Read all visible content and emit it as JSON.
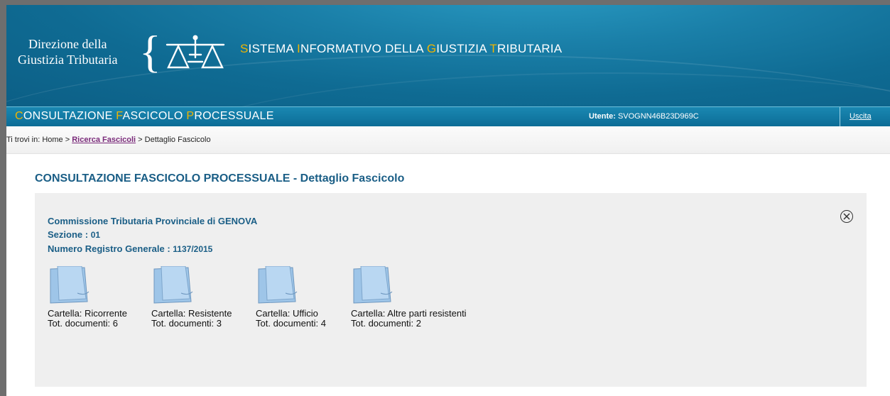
{
  "header": {
    "org_line1": "Direzione della",
    "org_line2": "Giustizia Tributaria",
    "system_title": [
      {
        "hl": "S",
        "rest": "ISTEMA "
      },
      {
        "hl": "I",
        "rest": "NFORMATIVO DELLA "
      },
      {
        "hl": "G",
        "rest": "IUSTIZIA "
      },
      {
        "hl": "T",
        "rest": "RIBUTARIA"
      }
    ]
  },
  "topbar": {
    "title": [
      {
        "hl": "C",
        "rest": "ONSULTAZIONE "
      },
      {
        "hl": "F",
        "rest": "ASCICOLO "
      },
      {
        "hl": "P",
        "rest": "ROCESSUALE"
      }
    ],
    "user_label": "Utente:",
    "user_value": "SVOGNN46B23D969C",
    "logout_label": "Uscita"
  },
  "breadcrumb": {
    "prefix": "Ti trovi in: Home > ",
    "link": "Ricerca Fascicoli",
    "suffix": " > Dettaglio Fascicolo"
  },
  "page": {
    "title": "CONSULTAZIONE FASCICOLO PROCESSUALE - Dettaglio Fascicolo"
  },
  "panel": {
    "commission": "Commissione Tributaria Provinciale di GENOVA",
    "section_label": "Sezione :",
    "section_value": "01",
    "registry_label": "Numero Registro Generale :",
    "registry_value": "1137/2015"
  },
  "folders": [
    {
      "name": "Cartella:  Ricorrente",
      "docs": "Tot. documenti:  6"
    },
    {
      "name": "Cartella:  Resistente",
      "docs": "Tot. documenti:  3"
    },
    {
      "name": "Cartella:  Ufficio",
      "docs": "Tot. documenti:  4"
    },
    {
      "name": "Cartella:  Altre parti resistenti",
      "docs": "Tot. documenti:  2"
    }
  ],
  "colors": {
    "banner": "#0f6b93",
    "highlight": "#f0b400",
    "title_blue": "#1a5e86",
    "panel_bg": "#efefef",
    "link_purple": "#7a2a7a"
  }
}
